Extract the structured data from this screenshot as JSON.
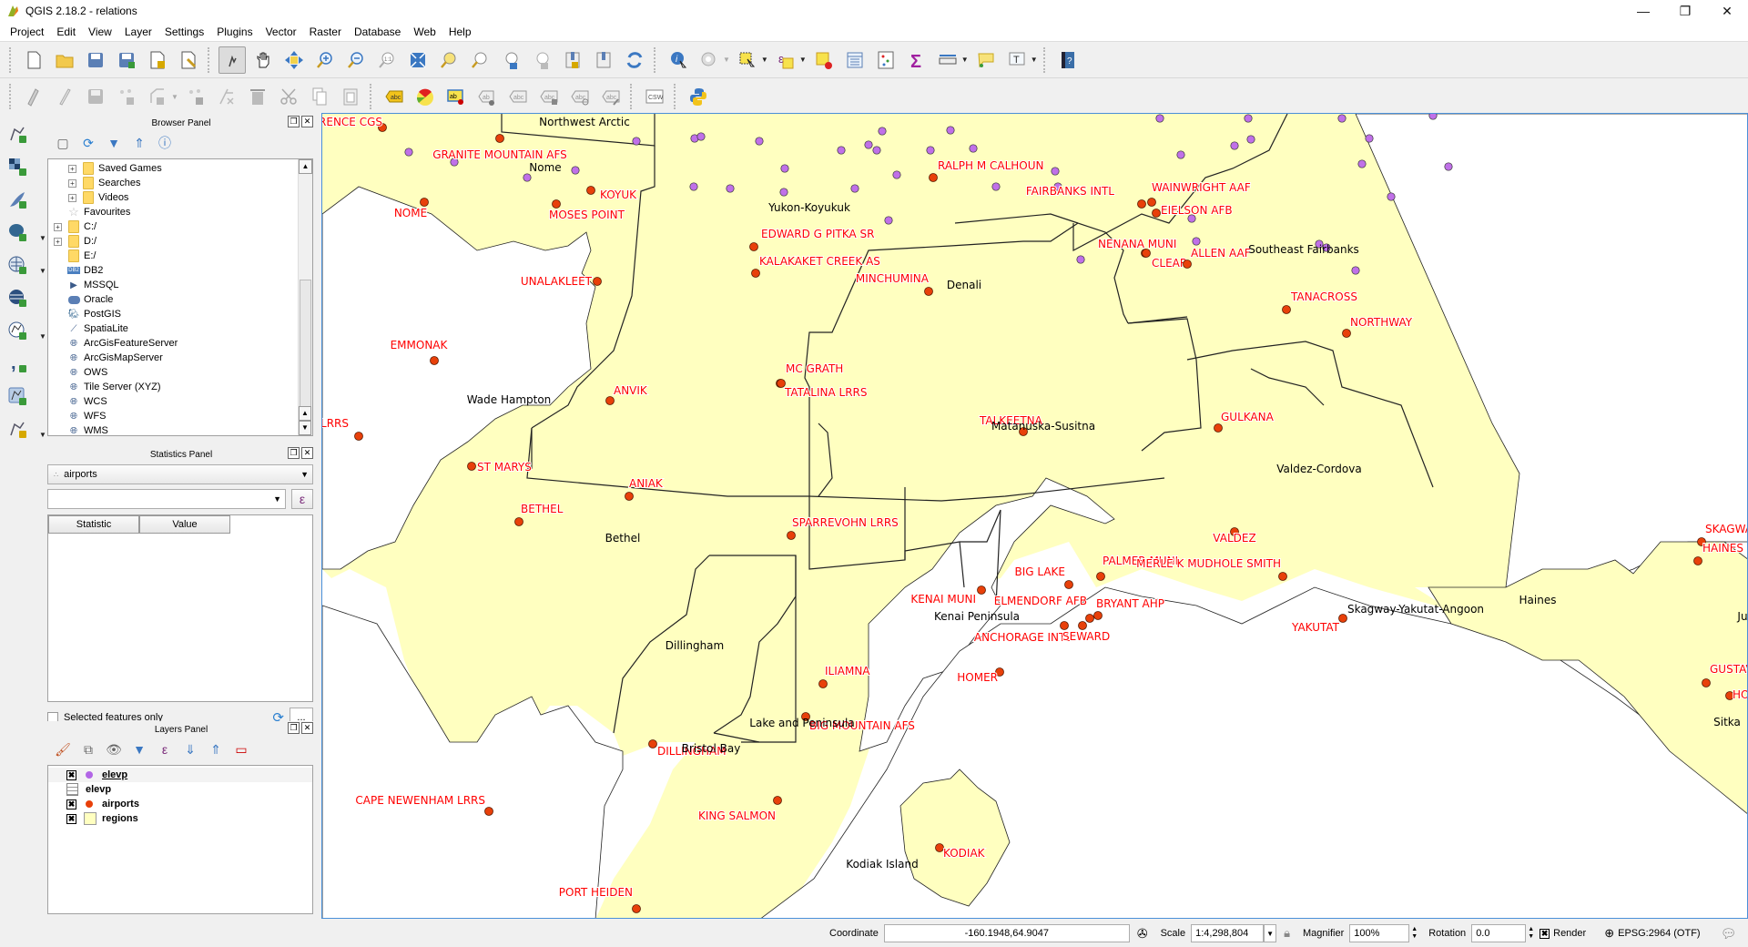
{
  "window": {
    "title": "QGIS 2.18.2 - relations",
    "controls": {
      "minimize": "—",
      "restore": "❐",
      "close": "✕"
    }
  },
  "menu": [
    "Project",
    "Edit",
    "View",
    "Layer",
    "Settings",
    "Plugins",
    "Vector",
    "Raster",
    "Database",
    "Web",
    "Help"
  ],
  "toolbar_main": [
    "new-project-icon",
    "open-project-icon",
    "save-project-icon",
    "save-as-icon",
    "new-print-composer-icon",
    "composer-manager-icon",
    "|",
    "touch-pan-icon",
    "pan-icon",
    "pan-to-selection-icon",
    "zoom-in-icon",
    "zoom-out-icon",
    "zoom-native-icon",
    "zoom-full-icon",
    "zoom-to-selection-icon",
    "zoom-to-layer-icon",
    "zoom-last-icon",
    "zoom-next-icon",
    "new-bookmark-icon",
    "show-bookmarks-icon",
    "refresh-icon",
    "|",
    "identify-icon",
    "run-action-icon",
    "select-feature-icon",
    "select-by-expression-icon",
    "deselect-icon",
    "attribute-table-icon",
    "field-calculator-icon",
    "statistical-summary-icon",
    "measure-icon",
    "map-tips-icon",
    "text-annotation-icon",
    "|",
    "help-icon"
  ],
  "toolbar_edit": [
    "current-edits-icon",
    "toggle-editing-icon",
    "save-edits-icon",
    "add-feature-icon",
    "node-tool-icon",
    "move-feature-icon",
    "delete-part-icon",
    "delete-selected-icon",
    "cut-features-icon",
    "copy-features-icon",
    "paste-features-icon",
    "|",
    "layer-labeling-icon",
    "layer-style-icon",
    "pin-labels-icon",
    "show-hide-labels-icon",
    "highlight-labels-icon",
    "move-label-icon",
    "rotate-label-icon",
    "change-label-icon",
    "|",
    "csw-icon",
    "|",
    "python-console-icon"
  ],
  "left_toolbar": [
    {
      "icon": "add-vector-layer-icon"
    },
    {
      "icon": "add-raster-layer-icon"
    },
    {
      "icon": "add-spatialite-layer-icon"
    },
    {
      "icon": "add-postgis-layer-icon",
      "dropdown": true
    },
    {
      "icon": "add-wms-layer-icon",
      "dropdown": true
    },
    {
      "icon": "add-wcs-layer-icon"
    },
    {
      "icon": "add-wfs-layer-icon",
      "dropdown": true
    },
    {
      "icon": "add-delimited-text-icon"
    },
    {
      "icon": "add-virtual-layer-icon"
    },
    {
      "icon": "new-shapefile-icon",
      "dropdown": true
    }
  ],
  "browser_panel": {
    "title": "Browser Panel",
    "tools": [
      "add-selected-icon",
      "refresh-icon",
      "filter-icon",
      "collapse-all-icon",
      "properties-icon"
    ],
    "items": [
      {
        "label": "Saved Games",
        "indent": 2,
        "expandable": true,
        "icon": "folder"
      },
      {
        "label": "Searches",
        "indent": 2,
        "expandable": true,
        "icon": "folder"
      },
      {
        "label": "Videos",
        "indent": 2,
        "expandable": true,
        "icon": "folder"
      },
      {
        "label": "Favourites",
        "indent": 1,
        "expandable": false,
        "icon": "star"
      },
      {
        "label": "C:/",
        "indent": 1,
        "expandable": true,
        "icon": "folder"
      },
      {
        "label": "D:/",
        "indent": 1,
        "expandable": true,
        "icon": "folder"
      },
      {
        "label": "E:/",
        "indent": 1,
        "expandable": false,
        "icon": "folder"
      },
      {
        "label": "DB2",
        "indent": 1,
        "expandable": false,
        "icon": "db2"
      },
      {
        "label": "MSSQL",
        "indent": 1,
        "expandable": false,
        "icon": "mssql"
      },
      {
        "label": "Oracle",
        "indent": 1,
        "expandable": false,
        "icon": "oracle"
      },
      {
        "label": "PostGIS",
        "indent": 1,
        "expandable": false,
        "icon": "postgis"
      },
      {
        "label": "SpatiaLite",
        "indent": 1,
        "expandable": false,
        "icon": "spatialite"
      },
      {
        "label": "ArcGisFeatureServer",
        "indent": 1,
        "expandable": false,
        "icon": "globe"
      },
      {
        "label": "ArcGisMapServer",
        "indent": 1,
        "expandable": false,
        "icon": "globe"
      },
      {
        "label": "OWS",
        "indent": 1,
        "expandable": false,
        "icon": "globe"
      },
      {
        "label": "Tile Server (XYZ)",
        "indent": 1,
        "expandable": false,
        "icon": "globe"
      },
      {
        "label": "WCS",
        "indent": 1,
        "expandable": false,
        "icon": "globe"
      },
      {
        "label": "WFS",
        "indent": 1,
        "expandable": false,
        "icon": "globe"
      },
      {
        "label": "WMS",
        "indent": 1,
        "expandable": false,
        "icon": "globe"
      }
    ]
  },
  "statistics_panel": {
    "title": "Statistics Panel",
    "layer": "airports",
    "field": "",
    "expression_button": "ε",
    "columns": [
      "Statistic",
      "Value"
    ],
    "selected_only_label": "Selected features only",
    "selected_only_checked": false,
    "more_button": "..."
  },
  "layers_panel": {
    "title": "Layers Panel",
    "tools": [
      "open-styling-icon",
      "add-group-icon",
      "manage-visibility-icon",
      "filter-legend-icon",
      "filter-by-expression-icon",
      "expand-all-icon",
      "collapse-all-icon",
      "remove-layer-icon"
    ],
    "layers": [
      {
        "name": "elevp",
        "visible": true,
        "symbol": "point",
        "color": "#b266e6",
        "current": true
      },
      {
        "name": "elevp",
        "visible": null,
        "symbol": "table",
        "color": "",
        "current": false
      },
      {
        "name": "airports",
        "visible": true,
        "symbol": "point",
        "color": "#e8400a",
        "current": false
      },
      {
        "name": "regions",
        "visible": true,
        "symbol": "polygon",
        "color": "#ffffc0",
        "current": false
      }
    ]
  },
  "map": {
    "colors": {
      "land": "#ffffc0",
      "border": "#222222",
      "airport": "#e8400a",
      "elev": "#c070e8",
      "airport_label": "#ff0000",
      "water": "#ffffff"
    },
    "regions": [
      "Northwest Arctic",
      "Nome",
      "Yukon-Koyukuk",
      "Denali",
      "Southeast Fairbanks",
      "Wade Hampton",
      "Matanuska-Susitna",
      "Valdez-Cordova",
      "Bethel",
      "Dillingham",
      "Lake and Peninsula",
      "Bristol Bay",
      "Kenai Peninsula",
      "Kodiak Island",
      "Skagway-Yakutat-Angoon",
      "Haines",
      "Ju",
      "Sitka"
    ],
    "airports": [
      "RENCE CGS",
      "GRANITE MOUNTAIN AFS",
      "KOYUK",
      "MOSES POINT",
      "NOME",
      "UNALAKLEET",
      "EMMONAK",
      "F LRRS",
      "ST MARYS",
      "ANVIK",
      "MC GRATH",
      "TATALINA LRRS",
      "EDWARD G PITKA SR",
      "KALAKAKET CREEK  AS",
      "RALPH M CALHOUN",
      "FAIRBANKS INTL",
      "WAINWRIGHT AAF",
      "EIELSON AFB",
      "NENANA MUNI",
      "CLEAR",
      "MINCHUMINA",
      "ALLEN AAF",
      "TANACROSS",
      "NORTHWAY",
      "TALKEETNA",
      "GULKANA",
      "ANIAK",
      "BETHEL",
      "SPARREVOHN LRRS",
      "BIG LAKE",
      "PALMER MUNI",
      "ELMENDORF AFB",
      "BRYANT AHP",
      "ANCHORAGE INTL",
      "VALDEZ",
      "MERLE K MUDHOLE SMITH",
      "KENAI MUNI",
      "SEWARD",
      "HOMER",
      "ILIAMNA",
      "BIG MOUNTAIN AFS",
      "DILLINGHAM",
      "CAPE NEWENHAM LRRS",
      "KING SALMON",
      "PORT HEIDEN",
      "KODIAK",
      "YAKUTAT",
      "SKAGWAY",
      "HAINES",
      "GUSTAVUS",
      "HOO"
    ]
  },
  "statusbar": {
    "coordinate_label": "Coordinate",
    "coordinate_value": "-160.1948,64.9047",
    "scale_label": "Scale",
    "scale_value": "1:4,298,804",
    "magnifier_label": "Magnifier",
    "magnifier_value": "100%",
    "rotation_label": "Rotation",
    "rotation_value": "0.0",
    "render_label": "Render",
    "render_checked": true,
    "crs": "EPSG:2964 (OTF)"
  }
}
